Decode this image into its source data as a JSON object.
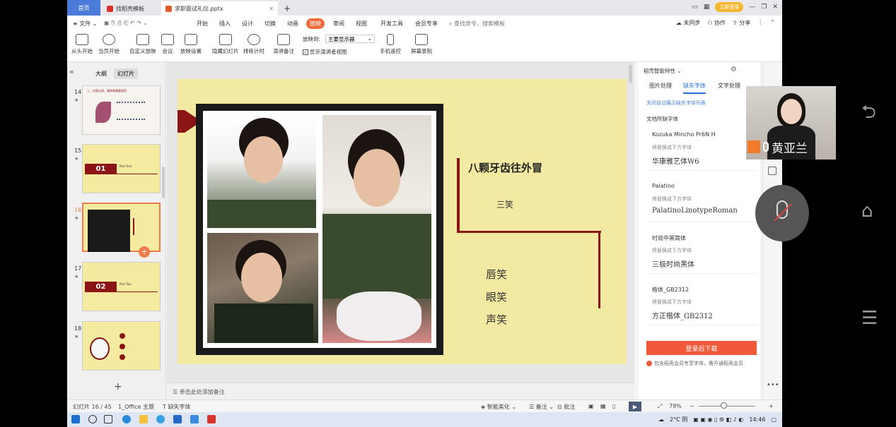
{
  "titlebar": {
    "home_tab": "首页",
    "tabs": [
      {
        "label": "找稻壳模板"
      },
      {
        "label": "求职面试礼仪.pptx"
      }
    ],
    "login_label": "立即登录"
  },
  "menu": {
    "file": "文件",
    "items": [
      "开始",
      "插入",
      "设计",
      "切换",
      "动画",
      "放映",
      "审阅",
      "视图",
      "开发工具",
      "会员专享"
    ],
    "active": "放映",
    "search_placeholder": "查找命令、搜索模板",
    "sync": "未同步",
    "collab": "协作",
    "share": "分享"
  },
  "ribbon": {
    "buttons": [
      "从头开始",
      "当页开始",
      "自定义放映",
      "会议",
      "放映设置",
      "隐藏幻灯片",
      "排练计时",
      "演讲备注"
    ],
    "show_on_label": "放映到:",
    "show_on_value": "主要显示器",
    "presenter_view": "显示演讲者视图",
    "phone_remote": "手机遥控",
    "screen_record": "屏幕录制"
  },
  "left_panel": {
    "tabs": [
      "大纲",
      "幻灯片"
    ],
    "active_tab": "幻灯片",
    "thumbnails": [
      {
        "num": "14",
        "caption": "三、仪容仪表、服饰装着要规范"
      },
      {
        "num": "15",
        "bar_text": "01",
        "part": "Part One"
      },
      {
        "num": "16"
      },
      {
        "num": "17",
        "bar_text": "02",
        "part": "Part Two"
      },
      {
        "num": "18"
      }
    ]
  },
  "slide": {
    "title": "八颗牙齿往外冒",
    "subtitle": "三笑",
    "smiles": [
      "唇笑",
      "眼笑",
      "声笑"
    ]
  },
  "notes_placeholder": "单击此处添加备注",
  "right_panel": {
    "title": "稻壳智能特性",
    "tabs": [
      "图片处理",
      "缺失字体",
      "文字处理"
    ],
    "active_tab": "缺失字体",
    "link": "关闭自动展示缺失字体列表",
    "section_label": "文档所缺字体",
    "fonts": [
      {
        "name": "Kozuka Mincho Pr6N H",
        "hint": "将替换成下方字体",
        "replacement": "华康雅艺体W6"
      },
      {
        "name": "Palatino",
        "hint": "将替换成下方字体",
        "replacement": "PalatinoLinotypeRoman"
      },
      {
        "name": "时尚中黑简体",
        "hint": "将替换成下方字体",
        "replacement": "三极时尚黑体"
      },
      {
        "name": "楷体_GB2312",
        "hint": "将替换成下方字体",
        "replacement": "方正楷体_GB2312"
      }
    ],
    "download_label": "登录后下载",
    "note": "包含稻壳会员专享字体，需开通稻壳会员"
  },
  "statusbar": {
    "slide_info": "幻灯片 16 / 45",
    "theme": "1_Office 主题",
    "missing_font": "缺失字体",
    "beautify": "智能美化",
    "notes": "备注",
    "comments": "批注",
    "zoom": "79%"
  },
  "taskbar": {
    "weather": "2°C 阴",
    "time": "14:46"
  },
  "video": {
    "name": "黄亚兰"
  }
}
